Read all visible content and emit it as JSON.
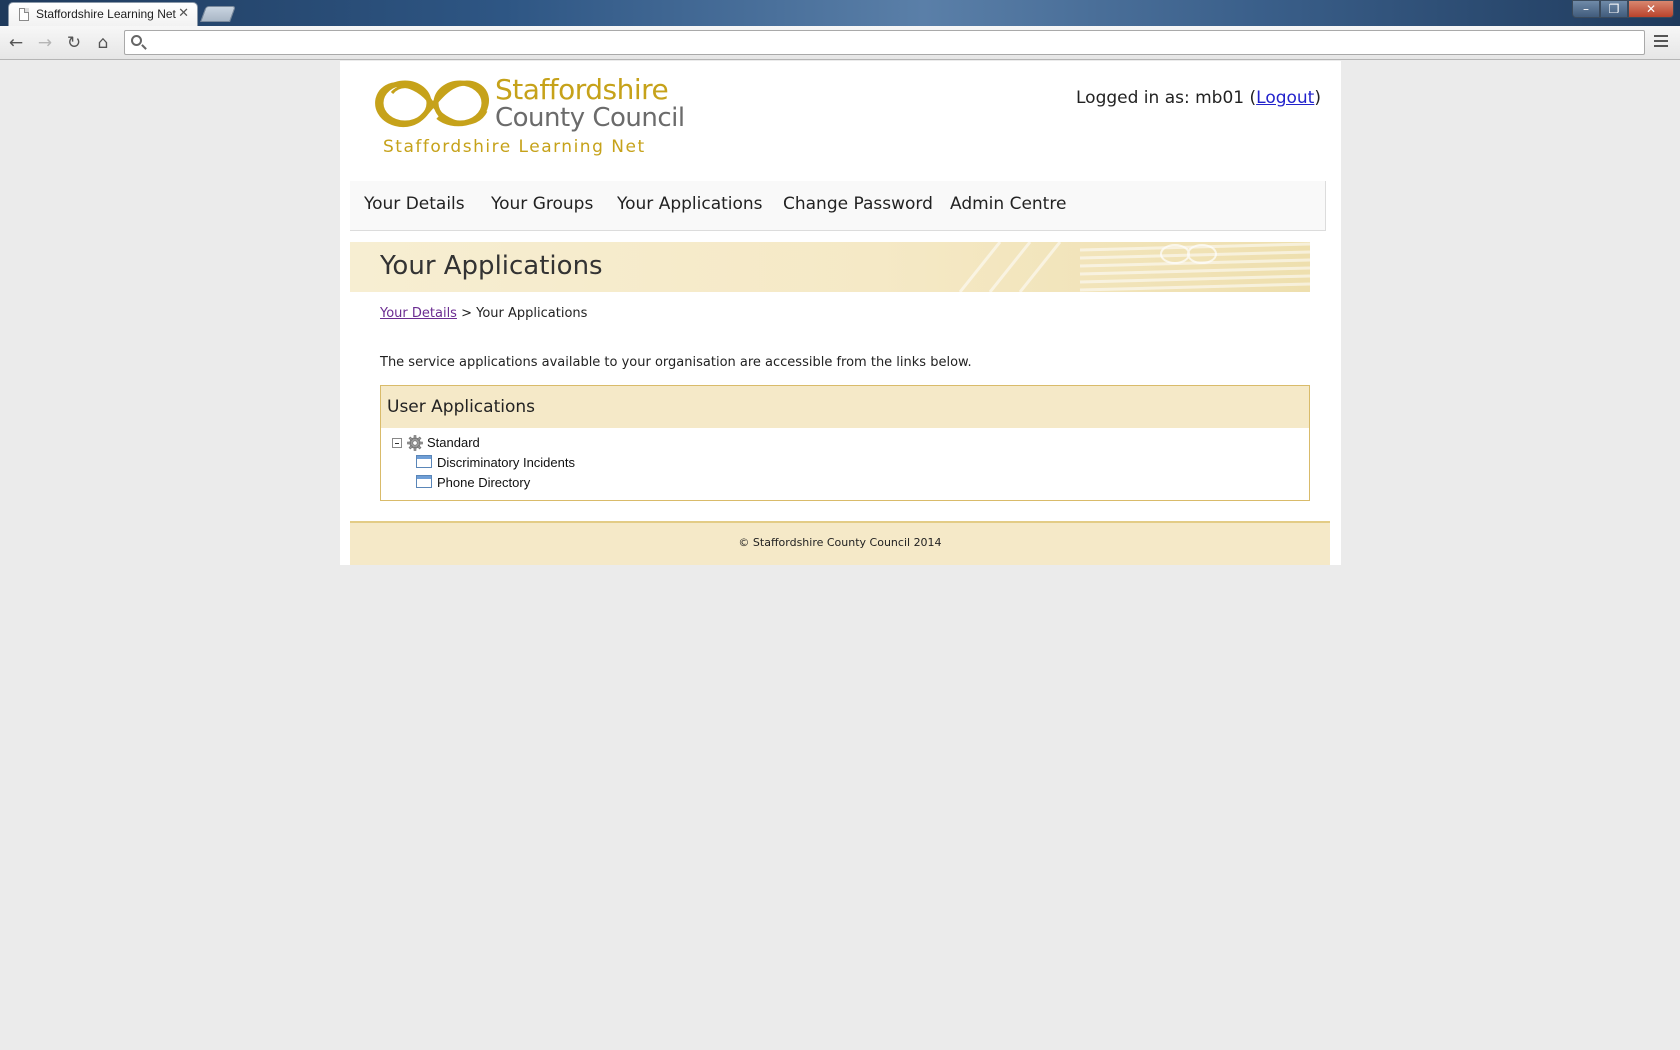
{
  "browser": {
    "tab_title": "Staffordshire Learning Net",
    "tab_close": "✕",
    "address_placeholder": "",
    "back": "←",
    "forward": "→",
    "reload": "↻",
    "home": "⌂",
    "window_controls": {
      "minimize": "–",
      "restore": "❐",
      "close": "✕"
    }
  },
  "header": {
    "logo": {
      "line1": "Staffordshire",
      "line2": "County Council",
      "line3": "Staffordshire Learning Net"
    },
    "login": {
      "prefix": "Logged in as: mb01  (",
      "logout_label": "Logout",
      "suffix": ")"
    }
  },
  "nav": {
    "items": [
      {
        "label": "Your Details"
      },
      {
        "label": "Your Groups"
      },
      {
        "label": "Your Applications"
      },
      {
        "label": "Change Password"
      },
      {
        "label": "Admin Centre"
      }
    ]
  },
  "main": {
    "page_title": "Your Applications",
    "breadcrumb": {
      "link": "Your Details",
      "separator": " > ",
      "current": "Your Applications"
    },
    "intro": "The service applications available to your organisation are accessible from the links below.",
    "apps_panel": {
      "title": "User Applications",
      "group": {
        "label": "Standard",
        "items": [
          {
            "label": "Discriminatory Incidents"
          },
          {
            "label": "Phone Directory"
          }
        ]
      }
    }
  },
  "footer": {
    "text": "© Staffordshire County Council 2014"
  },
  "colors": {
    "brand_gold": "#c6a21a",
    "panel_bg": "#f5e9c8",
    "panel_border": "#d9bb6a",
    "link_blue": "#2222cc",
    "visited_purple": "#6b2c91"
  },
  "icons": [
    "page-icon",
    "close-icon",
    "new-tab-icon",
    "back-arrow-icon",
    "forward-arrow-icon",
    "reload-icon",
    "home-icon",
    "search-icon",
    "menu-icon",
    "logo-knot-icon",
    "collapse-icon",
    "gear-icon",
    "window-icon"
  ]
}
